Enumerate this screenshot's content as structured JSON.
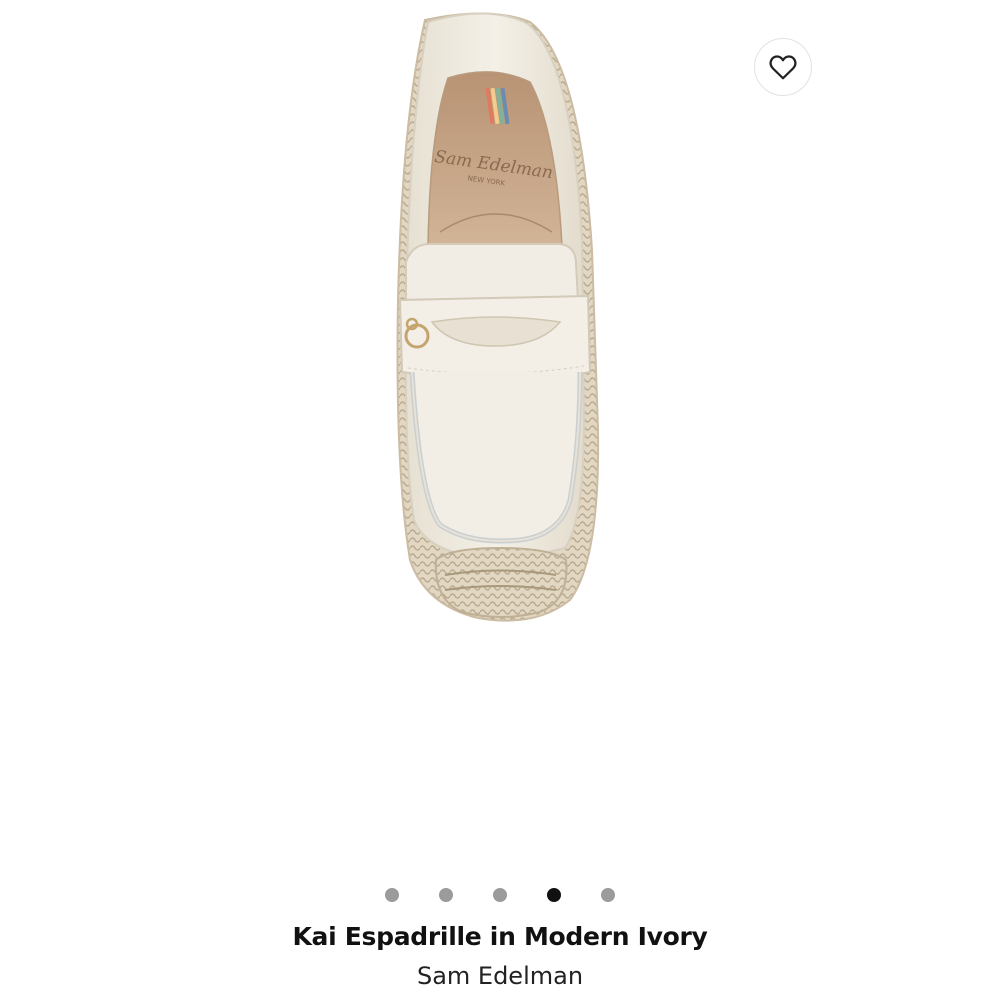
{
  "product": {
    "title": "Kai Espadrille in Modern Ivory",
    "brand": "Sam Edelman",
    "insole_brand": "Sam Edelman",
    "insole_sub": "NEW YORK",
    "image_icon": "shoe-top-view"
  },
  "favorite": {
    "icon": "heart-icon"
  },
  "carousel": {
    "total": 5,
    "active_index": 3
  },
  "colors": {
    "leather": "#efeadf",
    "insole": "#caa98a",
    "jute": "#d9cdb8",
    "active_dot": "#111111",
    "inactive_dot": "#9b9b9b"
  }
}
